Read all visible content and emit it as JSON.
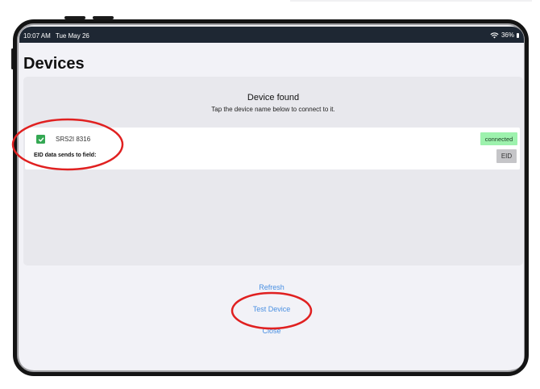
{
  "status_bar": {
    "time": "10:07 AM",
    "date": "Tue May 26",
    "battery": "36%"
  },
  "page": {
    "title": "Devices"
  },
  "card": {
    "title": "Device found",
    "subtitle": "Tap the device name below to connect to it."
  },
  "device": {
    "name": "SRS2I 8316",
    "checked": true,
    "status": "connected",
    "field_label": "EID data sends to field:",
    "field_button": "EID"
  },
  "actions": {
    "refresh": "Refresh",
    "test": "Test Device",
    "close": "Close"
  },
  "colors": {
    "status_bar": "#1e2733",
    "link": "#4a90e2",
    "checkbox": "#34a853",
    "connected_badge": "#9df2ad",
    "annotation": "#e02020"
  }
}
